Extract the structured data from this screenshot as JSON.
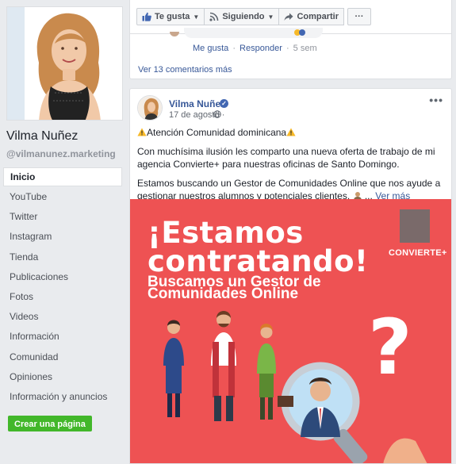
{
  "profile": {
    "name": "Vilma Nuñez",
    "handle": "@vilmanunez.marketing"
  },
  "nav": {
    "items": [
      "Inicio",
      "YouTube",
      "Twitter",
      "Instagram",
      "Tienda",
      "Publicaciones",
      "Fotos",
      "Videos",
      "Información",
      "Comunidad",
      "Opiniones",
      "Información y anuncios"
    ],
    "active": "Inicio",
    "create_page": "Crear una página"
  },
  "actions": {
    "like": "Te gusta",
    "following": "Siguiendo",
    "share": "Compartir",
    "more": "···"
  },
  "comment": {
    "like": "Me gusta",
    "reply": "Responder",
    "time": "5 sem",
    "sep": "·",
    "more_comments": "Ver 13 comentarios más"
  },
  "post": {
    "author": "Vilma Nuñez",
    "date": "17 de agosto",
    "date_sep": "·",
    "options": "•••",
    "headline": "Atención Comunidad dominicana",
    "paragraph1": "Con muchísima ilusión les comparto una nueva oferta de trabajo de mi agencia Convierte+ para nuestras oficinas de Santo Domingo.",
    "paragraph2": "Estamos buscando un Gestor de Comunidades Online que nos ayude a gestionar nuestros alumnos y potenciales clientes.",
    "see_more": "Ver más"
  },
  "image": {
    "headline_line1": "¡Estamos",
    "headline_line2": "contratando!",
    "sub_line1": "Buscamos un Gestor de",
    "sub_line2": "Comunidades Online",
    "brand": "CONVIERTE+",
    "question_mark": "?"
  },
  "colors": {
    "page_bg": "#e9ebee",
    "link": "#385898",
    "brand_blue": "#4267b2",
    "create_green": "#42b72a",
    "image_red": "#ee5253"
  },
  "icons": [
    "thumbs-up-icon",
    "rss-icon",
    "share-arrow-icon",
    "more-dots-icon",
    "verified-icon",
    "globe-icon",
    "warning-icon",
    "magnifying-glass-icon",
    "question-mark-icon"
  ]
}
